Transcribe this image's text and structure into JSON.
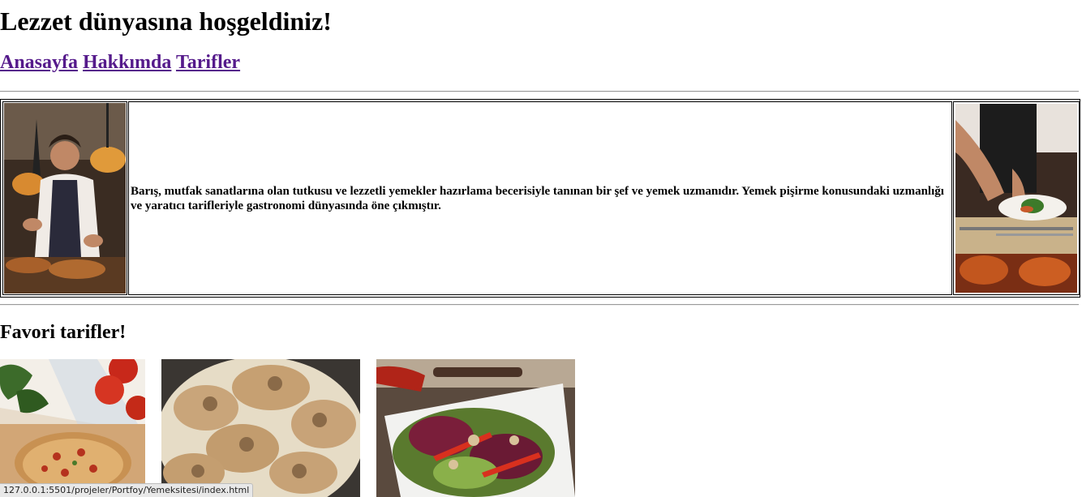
{
  "header": {
    "title": "Lezzet dünyasına hoşgeldiniz!"
  },
  "nav": {
    "links": [
      {
        "label": "Anasayfa"
      },
      {
        "label": "Hakkımda"
      },
      {
        "label": "Tarifler"
      }
    ],
    "link_color": "#551a8b"
  },
  "bio": {
    "text": "Barış, mutfak sanatlarına olan tutkusu ve lezzetli yemekler hazırlama becerisiyle tanınan bir şef ve yemek uzmanıdır. Yemek pişirme konusundaki uzmanlığı ve yaratıcı tarifleriyle gastronomi dünyasında öne çıkmıştır."
  },
  "favorites": {
    "heading": "Favori tarifler!"
  },
  "status_bar": {
    "url": "127.0.0.1:5501/projeler/Portfoy/Yemeksitesi/index.html"
  }
}
